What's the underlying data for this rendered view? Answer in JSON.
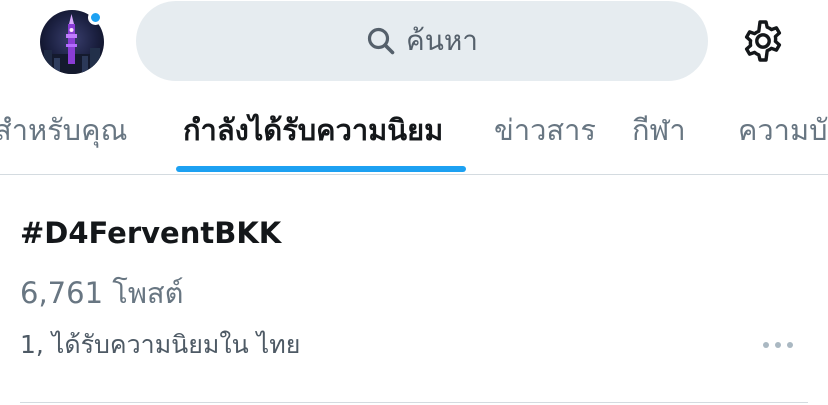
{
  "header": {
    "search_placeholder": "ค้นหา",
    "search_icon": "search-icon",
    "settings_icon": "gear-icon",
    "avatar_badge_color": "#1da1f2"
  },
  "tabs": [
    {
      "label": "สำหรับคุณ",
      "active": false
    },
    {
      "label": "กำลังได้รับความนิยม",
      "active": true
    },
    {
      "label": "ข่าวสาร",
      "active": false
    },
    {
      "label": "กีฬา",
      "active": false
    },
    {
      "label": "ความบั",
      "active": false
    }
  ],
  "trend": {
    "name": "#D4FerventBKK",
    "post_count": "6,761 โพสต์",
    "rank_label": "1, ได้รับความนิยมใน ไทย",
    "more_icon": "more-horizontal-icon"
  },
  "colors": {
    "accent": "#1da1f2",
    "text_primary": "#14171a",
    "text_secondary": "#687682",
    "search_bg": "#e6ecf0"
  }
}
